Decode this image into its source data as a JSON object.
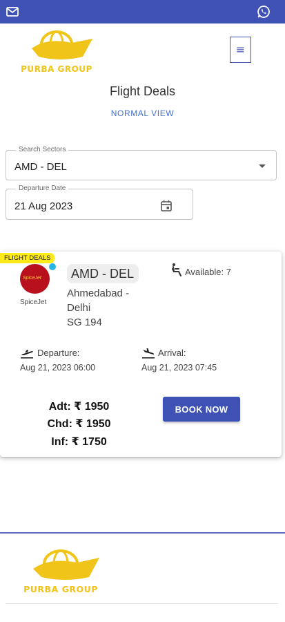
{
  "topbar": {
    "mail_icon": "mail-icon",
    "whatsapp_icon": "whatsapp-icon",
    "color": "#3f51b5"
  },
  "header": {
    "logo_text": "PURBA GROUP",
    "menu_icon": "hamburger-menu-icon",
    "menu_glyph": "≡"
  },
  "page": {
    "title": "Flight Deals",
    "view_toggle": "NORMAL VIEW"
  },
  "search": {
    "sectors_label": "Search Sectors",
    "sectors_value": "AMD - DEL",
    "date_label": "Departure Date",
    "date_value": "21 Aug 2023"
  },
  "deal": {
    "tag": "FLIGHT DEALS",
    "airline_logo_text": "SpiceJet",
    "airline": "SpiceJet",
    "sector": "AMD - DEL",
    "route": "Ahmedabad - Delhi",
    "flight_no": "SG 194",
    "available": "Available: 7",
    "departure_label": "Departure:",
    "departure_time": "Aug 21, 2023 06:00",
    "arrival_label": "Arrival:",
    "arrival_time": "Aug 21, 2023 07:45",
    "fare_adt": "Adt: ₹ 1950",
    "fare_chd": "Chd: ₹ 1950",
    "fare_inf": "Inf: ₹ 1750",
    "book_label": "BOOK NOW"
  },
  "footer": {
    "logo_text": "PURBA GROUP"
  },
  "colors": {
    "primary": "#3f51b5",
    "link": "#3f6fd8",
    "tag": "#ffeb1a",
    "logo_gold": "#f0c419"
  }
}
